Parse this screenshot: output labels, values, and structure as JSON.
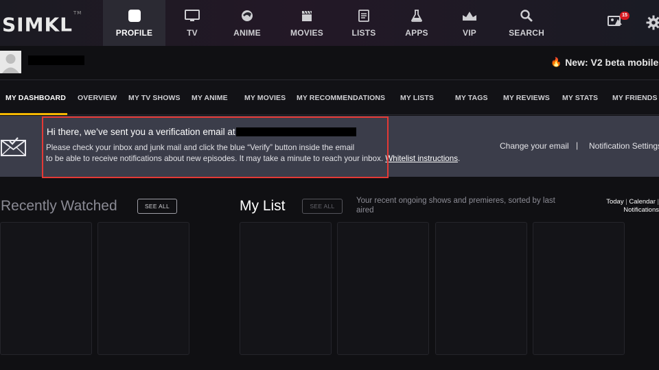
{
  "brand": {
    "logo": "SIMKL",
    "tm": "TM"
  },
  "nav": {
    "items": [
      {
        "label": "PROFILE",
        "icon": "profile-square-icon",
        "active": true
      },
      {
        "label": "TV",
        "icon": "tv-icon"
      },
      {
        "label": "ANIME",
        "icon": "anime-icon"
      },
      {
        "label": "MOVIES",
        "icon": "clapperboard-icon"
      },
      {
        "label": "LISTS",
        "icon": "list-icon"
      },
      {
        "label": "APPS",
        "icon": "flask-icon"
      },
      {
        "label": "VIP",
        "icon": "crown-icon"
      },
      {
        "label": "SEARCH",
        "icon": "search-icon"
      }
    ],
    "message_badge": "15"
  },
  "user": {
    "beta_link": "New: V2 beta mobile"
  },
  "tabs": [
    "MY DASHBOARD",
    "OVERVIEW",
    "MY TV SHOWS",
    "MY ANIME",
    "MY MOVIES",
    "MY RECOMMENDATIONS",
    "MY LISTS",
    "MY TAGS",
    "MY REVIEWS",
    "MY STATS",
    "MY FRIENDS"
  ],
  "banner": {
    "title": "Hi there, we’ve sent you a verification email at",
    "line1": "Please check your inbox and junk mail and click the blue “Verify” button inside the email",
    "line2": "to be able to receive notifications about new episodes. It may take a minute to reach your inbox.",
    "whitelist": "Whitelist instructions",
    "period": ".",
    "change_email": "Change your email",
    "separator": "|",
    "notification_settings": "Notification Settings"
  },
  "recently_watched": {
    "title": "Recently Watched",
    "see_all": "SEE ALL"
  },
  "my_list": {
    "title": "My List",
    "see_all": "SEE ALL",
    "description": "Your recent ongoing shows and premieres, sorted by last aired",
    "today": "Today",
    "pipe": "|",
    "calendar": "Calendar",
    "notifications": "Notifications"
  },
  "colors": {
    "accent": "#f5b800",
    "banner_bg": "#3b3d4a",
    "highlight": "#e53935",
    "badge": "#d71920"
  }
}
